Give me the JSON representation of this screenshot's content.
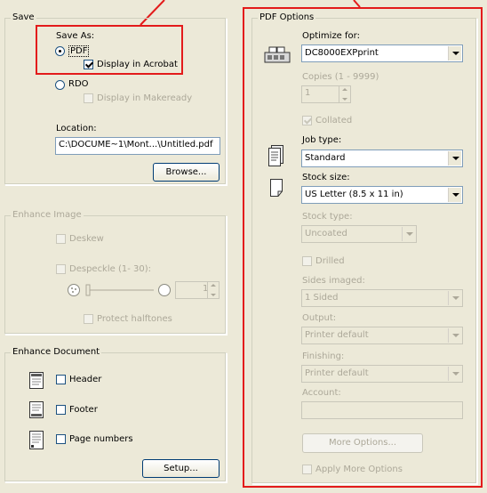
{
  "save": {
    "legend": "Save",
    "save_as_label": "Save As:",
    "pdf_label": "PDF",
    "display_acrobat_label": "Display in Acrobat",
    "rdo_label": "RDO",
    "display_makeready_label": "Display in Makeready",
    "location_label": "Location:",
    "location_value": "C:\\DOCUME~1\\Mont...\\Untitled.pdf",
    "browse_label": "Browse..."
  },
  "enhance_image": {
    "legend": "Enhance Image",
    "deskew_label": "Deskew",
    "despeckle_label": "Despeckle (1- 30):",
    "despeckle_value": "1",
    "protect_halftones_label": "Protect halftones"
  },
  "enhance_document": {
    "legend": "Enhance Document",
    "header_label": "Header",
    "footer_label": "Footer",
    "page_numbers_label": "Page numbers",
    "setup_label": "Setup..."
  },
  "pdf_options": {
    "legend": "PDF Options",
    "optimize_label": "Optimize for:",
    "optimize_value": "DC8000EXPprint",
    "copies_label": "Copies (1 - 9999)",
    "copies_value": "1",
    "collated_label": "Collated",
    "job_type_label": "Job type:",
    "job_type_value": "Standard",
    "stock_size_label": "Stock size:",
    "stock_size_value": "US Letter (8.5 x 11 in)",
    "stock_type_label": "Stock type:",
    "stock_type_value": "Uncoated",
    "drilled_label": "Drilled",
    "sides_label": "Sides imaged:",
    "sides_value": "1 Sided",
    "output_label": "Output:",
    "output_value": "Printer default",
    "finishing_label": "Finishing:",
    "finishing_value": "Printer default",
    "account_label": "Account:",
    "account_value": "",
    "more_options_label": "More Options...",
    "apply_more_label": "Apply More Options"
  },
  "colors": {
    "highlight": "#e31b1b",
    "background": "#ece9d8",
    "disabled_text": "#aca899"
  },
  "icons": [
    "printer-icon",
    "job-document-icon",
    "page-icon",
    "header-icon",
    "footer-icon",
    "page-numbers-icon",
    "despeckle-small-icon",
    "despeckle-large-icon"
  ]
}
